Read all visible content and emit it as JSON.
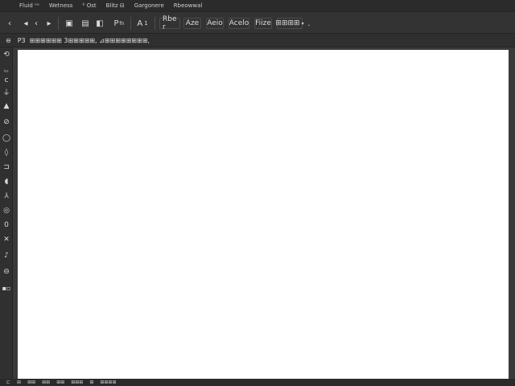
{
  "menu": [
    "Fluid ᵛᵉ",
    "Wetness",
    "ᵇ Ost",
    "Blitz ⊟",
    "Gargonere",
    "Rbeowwal"
  ],
  "toolbar": {
    "icons": [
      "back-icon",
      "forward-icon",
      "play-icon",
      "save-icon",
      "export-icon",
      "share-icon",
      "text-icon",
      "font-icon"
    ],
    "labels": [
      "Rbe r",
      "Aze",
      "Aeio",
      "Acelo",
      "Fiize",
      "⊞⊞⊞⊞"
    ],
    "p_label": "P",
    "p_sub": "fn",
    "a_label": "A",
    "a_sub": "1",
    "dropdown_caret": "▾",
    "trailing": "."
  },
  "options": {
    "label": "P3",
    "path_text": "⊞⊞⊞⊞⊞⊞ 3⊞⊞⊞⊞⊞, ⊿⊞⊞⊞⊞⊞⊞⊞⊞,"
  },
  "tools": [
    "lasso-icon",
    "hand-icon",
    "brush-icon",
    "drop-icon",
    "smudge-icon",
    "shape-icon",
    "pen-icon",
    "text-tool-icon",
    "eraser-icon",
    "gradient-icon",
    "blur-icon",
    "stamp-icon",
    "dodge-icon",
    "zoom-icon",
    "swatch-icon"
  ],
  "status": [
    "⊏",
    "⊞",
    "⊞⊞",
    "⊞⊞",
    "⊞⊞",
    "⊞⊞⊞",
    "⊞",
    "⊞⊞⊞⊞"
  ]
}
